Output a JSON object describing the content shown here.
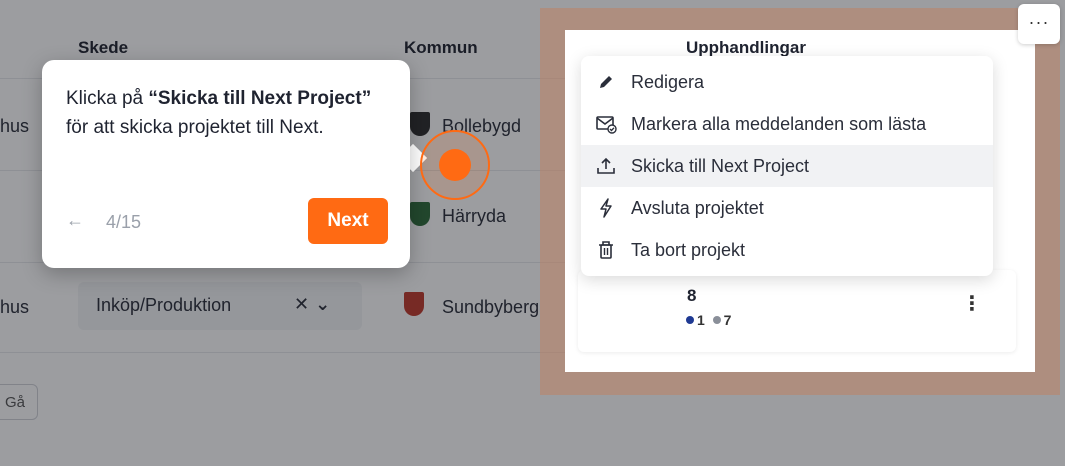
{
  "table": {
    "headers": {
      "stage": "Skede",
      "municipality": "Kommun",
      "procurements": "Upphandlingar"
    },
    "rows": [
      {
        "type_fragment": "hus",
        "municipality": "Bollebygd",
        "crest_color": "#2b2b2b"
      },
      {
        "type_fragment": "",
        "municipality": "Härryda",
        "crest_color": "#2e6b3a"
      },
      {
        "type_fragment": "hus",
        "stage": "Inköp/Produktion",
        "municipality": "Sundbyberg",
        "crest_color": "#c0392b",
        "procurement_count": "8",
        "badge_blue": "1",
        "badge_gray": "7"
      }
    ],
    "go_button": "Gå"
  },
  "menu": {
    "items": [
      {
        "label": "Redigera",
        "icon": "pencil-icon"
      },
      {
        "label": "Markera alla meddelanden som lästa",
        "icon": "mail-check-icon"
      },
      {
        "label": "Skicka till Next Project",
        "icon": "upload-icon",
        "active": true
      },
      {
        "label": "Avsluta projektet",
        "icon": "lightning-icon"
      },
      {
        "label": "Ta bort projekt",
        "icon": "trash-icon"
      }
    ]
  },
  "tooltip": {
    "text_pre": "Klicka på ",
    "text_bold": "“Skicka till Next Project”",
    "text_post": " för att skicka projektet till Next.",
    "step": "4/15",
    "next_label": "Next"
  },
  "corner_button": "···",
  "colors": {
    "accent": "#ff6a13",
    "badge_blue": "#1f3a93",
    "badge_gray": "#8a8f99"
  }
}
